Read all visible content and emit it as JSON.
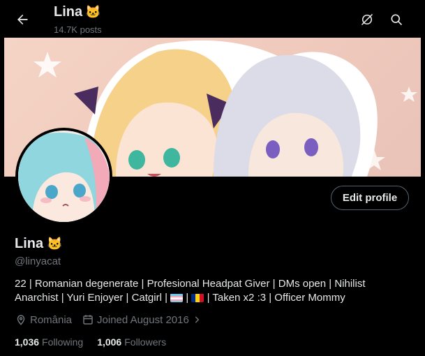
{
  "header": {
    "name": "Lina",
    "name_emoji": "🐱",
    "posts": "14.7K posts",
    "back_icon": "arrow-left-icon",
    "right_icons": [
      "no-notify-icon",
      "search-icon"
    ]
  },
  "profile": {
    "name": "Lina",
    "name_emoji": "🐱",
    "handle": "@linyacat",
    "edit_label": "Edit profile",
    "bio_line1": "22 | Romanian degenerate | Profesional Headpat Giver | DMs open | Nihilist",
    "bio_line2_a": "Anarchist | Yuri Enjoyer | Catgirl | ",
    "bio_sep": " | ",
    "bio_line2_b": " | Taken x2 :3 | Officer Mommy",
    "location": "România",
    "joined": "Joined August 2016",
    "following_count": "1,036",
    "following_label": "Following",
    "followers_count": "1,006",
    "followers_label": "Followers"
  },
  "colors": {
    "background": "#000000",
    "text_primary": "#e7e9ea",
    "text_secondary": "#71767b",
    "border": "#536471"
  }
}
